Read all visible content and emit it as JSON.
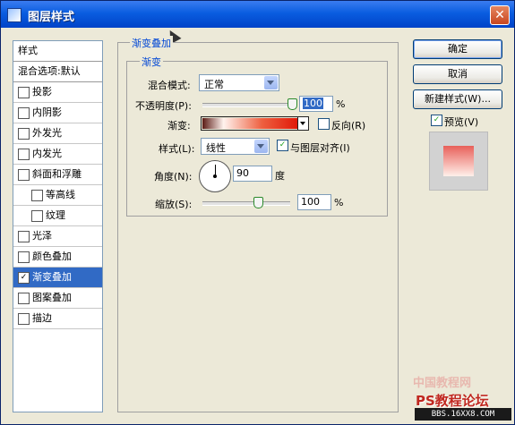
{
  "window": {
    "title": "图层样式",
    "close": "✕"
  },
  "style_list": {
    "header": "样式",
    "blend_options": "混合选项:默认",
    "items": [
      {
        "label": "投影",
        "checked": false
      },
      {
        "label": "内阴影",
        "checked": false
      },
      {
        "label": "外发光",
        "checked": false
      },
      {
        "label": "内发光",
        "checked": false
      },
      {
        "label": "斜面和浮雕",
        "checked": false
      },
      {
        "label": "等高线",
        "checked": false
      },
      {
        "label": "纹理",
        "checked": false
      },
      {
        "label": "光泽",
        "checked": false
      },
      {
        "label": "颜色叠加",
        "checked": false
      },
      {
        "label": "渐变叠加",
        "checked": true
      },
      {
        "label": "图案叠加",
        "checked": false
      },
      {
        "label": "描边",
        "checked": false
      }
    ]
  },
  "panel": {
    "group_title": "渐变叠加",
    "inner_group_title": "渐变",
    "blend_mode_label": "混合模式:",
    "blend_mode_value": "正常",
    "opacity_label": "不透明度(P):",
    "opacity_value": "100",
    "opacity_unit": "%",
    "opacity_level": 1.0,
    "gradient_label": "渐变:",
    "gradient_colors": [
      "#5a1a14",
      "#fff3ee",
      "#ee6040",
      "#e01808"
    ],
    "reverse_label": "反向(R)",
    "reverse_checked": false,
    "style_label": "样式(L):",
    "style_value": "线性",
    "align_label": "与图层对齐(I)",
    "align_checked": true,
    "angle_label": "角度(N):",
    "angle_value": "90",
    "angle_unit": "度",
    "scale_label": "缩放(S):",
    "scale_value": "100",
    "scale_unit": "%",
    "scale_level": 0.5
  },
  "buttons": {
    "ok": "确定",
    "cancel": "取消",
    "new_style": "新建样式(W)...",
    "preview_label": "预览(V)",
    "preview_checked": true
  },
  "watermark": {
    "main": "中国教程网",
    "sub": "PS教程论坛",
    "url": "BBS.16XX8.COM"
  },
  "colors": {
    "titlebar": "#0a5de0",
    "selection": "#316ac5",
    "dialog_bg": "#ece9d8"
  }
}
